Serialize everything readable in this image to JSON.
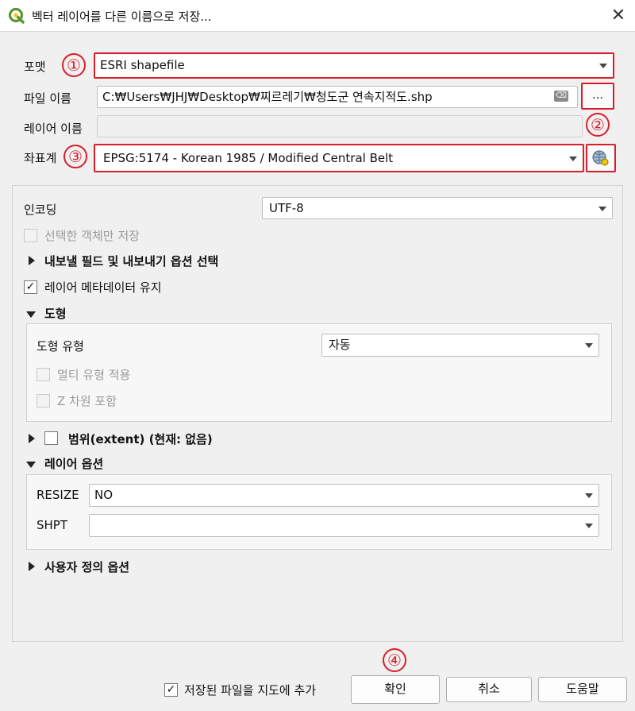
{
  "window": {
    "title": "벡터 레이어를 다른 이름으로 저장...",
    "close_glyph": "✕"
  },
  "header": {
    "format_label": "포맷",
    "format_value": "ESRI shapefile",
    "filename_label": "파일 이름",
    "filename_value": "C:₩Users₩JHJ₩Desktop₩찌르레기₩청도군 연속지적도.shp",
    "clear_glyph": "⌫",
    "browse_label": "…",
    "layername_label": "레이어 이름",
    "layername_value": "",
    "crs_label": "좌표계",
    "crs_value": "EPSG:5174 - Korean 1985 / Modified Central Belt"
  },
  "annotations": [
    "①",
    "②",
    "③",
    "④"
  ],
  "options": {
    "encoding_label": "인코딩",
    "encoding_value": "UTF-8",
    "selected_only_label": "선택한 객체만 저장",
    "export_fields_label": "내보낼 필드 및 내보내기 옵션 선택",
    "keep_metadata_label": "레이어 메타데이터 유지",
    "keep_metadata_checked": "✓",
    "geometry": {
      "header": "도형",
      "type_label": "도형 유형",
      "type_value": "자동",
      "multi_label": "멀티 유형 적용",
      "z_label": "Z 차원 포함"
    },
    "extent_label": "범위(extent) (현재: 없음)",
    "layer_options": {
      "header": "레이어 옵션",
      "resize_label": "RESIZE",
      "resize_value": "NO",
      "shpt_label": "SHPT",
      "shpt_value": ""
    },
    "custom_options_label": "사용자 정의 옵션"
  },
  "footer": {
    "add_to_map_checked": "✓",
    "add_to_map_label": "저장된 파일을 지도에 추가",
    "ok_label": "확인",
    "cancel_label": "취소",
    "help_label": "도움말"
  },
  "colors": {
    "annotation_red": "#d81e2a",
    "qgis_green": "#589632",
    "qgis_yellow": "#eec90d"
  }
}
